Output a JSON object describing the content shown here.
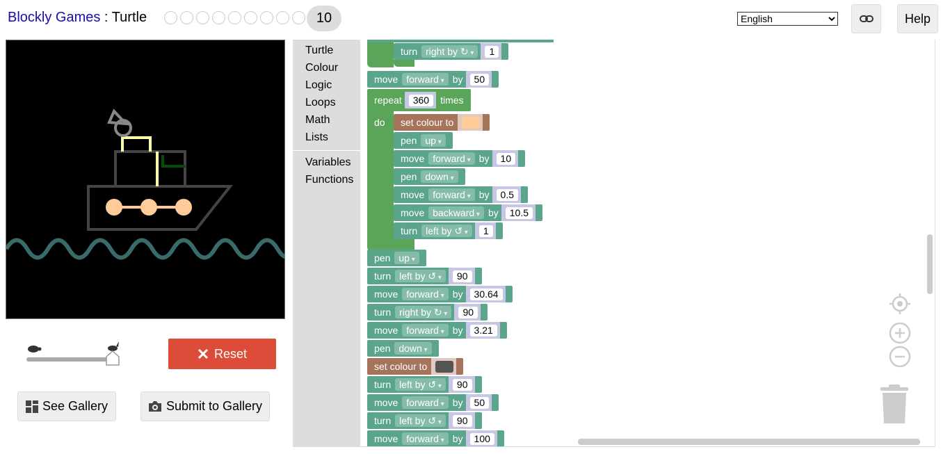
{
  "header": {
    "app_name": "Blockly Games",
    "separator": " : ",
    "game_name": "Turtle",
    "level_dots": 9,
    "current_level": "10",
    "language": "English",
    "link_icon": "link-icon",
    "help_label": "Help"
  },
  "controls": {
    "reset_label": "Reset",
    "gallery_label": "See Gallery",
    "submit_label": "Submit to Gallery",
    "slow_icon": "turtle-icon",
    "fast_icon": "rabbit-icon",
    "speed_value": 1.0
  },
  "toolbox": {
    "categories": [
      "Turtle",
      "Colour",
      "Logic",
      "Loops",
      "Math",
      "Lists"
    ],
    "extra": [
      "Variables",
      "Functions"
    ]
  },
  "program": {
    "b0": {
      "kw": "turn",
      "dd": "right by ↻",
      "val": "1"
    },
    "b1": {
      "kw": "move",
      "dd": "forward",
      "by": "by",
      "val": "50"
    },
    "b2": {
      "kw": "repeat",
      "val": "360",
      "tail": "times",
      "do": "do"
    },
    "b3": {
      "kw": "set colour to",
      "color": "#ffcc99"
    },
    "b4": {
      "kw": "pen",
      "dd": "up"
    },
    "b5": {
      "kw": "move",
      "dd": "forward",
      "by": "by",
      "val": "10"
    },
    "b6": {
      "kw": "pen",
      "dd": "down"
    },
    "b7": {
      "kw": "move",
      "dd": "forward",
      "by": "by",
      "val": "0.5"
    },
    "b8": {
      "kw": "move",
      "dd": "backward",
      "by": "by",
      "val": "10.5"
    },
    "b9": {
      "kw": "turn",
      "dd": "left by ↺",
      "val": "1"
    },
    "b10": {
      "kw": "pen",
      "dd": "up"
    },
    "b11": {
      "kw": "turn",
      "dd": "left by ↺",
      "val": "90"
    },
    "b12": {
      "kw": "move",
      "dd": "forward",
      "by": "by",
      "val": "30.64"
    },
    "b13": {
      "kw": "turn",
      "dd": "right by ↻",
      "val": "90"
    },
    "b14": {
      "kw": "move",
      "dd": "forward",
      "by": "by",
      "val": "3.21"
    },
    "b15": {
      "kw": "pen",
      "dd": "down"
    },
    "b16": {
      "kw": "set colour to",
      "color": "#555555"
    },
    "b17": {
      "kw": "turn",
      "dd": "left by ↺",
      "val": "90"
    },
    "b18": {
      "kw": "move",
      "dd": "forward",
      "by": "by",
      "val": "50"
    },
    "b19": {
      "kw": "turn",
      "dd": "left by ↺",
      "val": "90"
    },
    "b20": {
      "kw": "move",
      "dd": "forward",
      "by": "by",
      "val": "100"
    }
  },
  "colors": {
    "motion": "#5ba58c",
    "colour": "#a5745b",
    "loop": "#5ba55b",
    "reset": "#dd4b39",
    "link": "#1a0dab"
  }
}
